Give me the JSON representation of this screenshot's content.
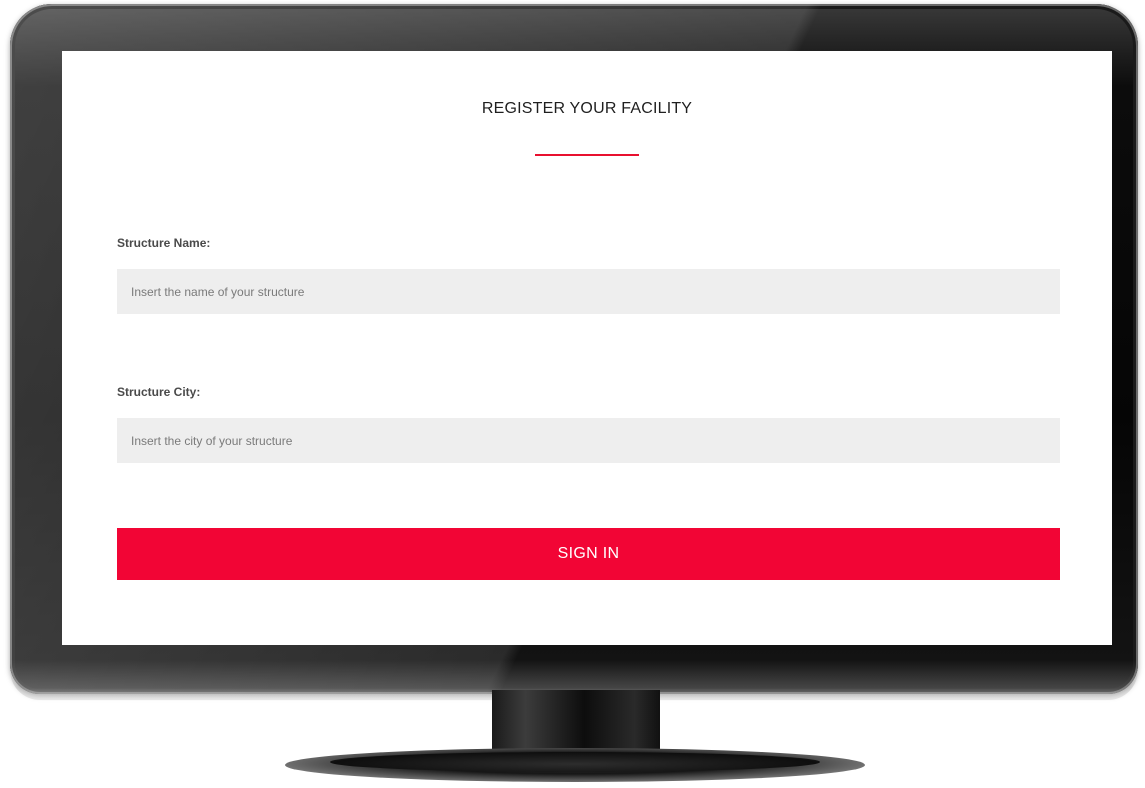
{
  "form": {
    "title": "REGISTER YOUR FACILITY",
    "fields": [
      {
        "label": "Structure Name:",
        "placeholder": "Insert the name of your structure",
        "value": ""
      },
      {
        "label": "Structure City:",
        "placeholder": "Insert the city of your structure",
        "value": ""
      }
    ],
    "submit_label": "SIGN IN"
  },
  "colors": {
    "accent": "#f20535",
    "title_rule": "#e8102f",
    "input_background": "#eeeeee",
    "bezel": "#0a0a0a"
  }
}
